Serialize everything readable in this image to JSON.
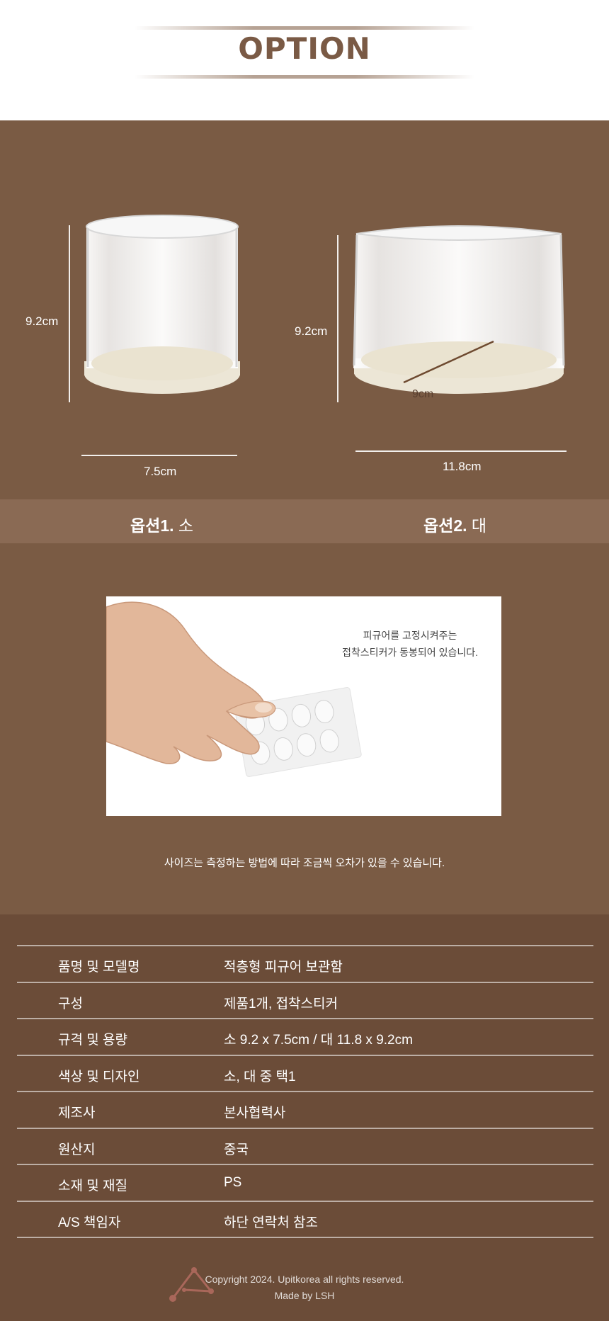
{
  "header": {
    "title": "OPTION"
  },
  "options": {
    "small": {
      "height_label": "9.2cm",
      "width_label": "7.5cm",
      "name_bold": "옵션1.",
      "name_size": "소"
    },
    "large": {
      "height_label": "9.2cm",
      "diameter_label": "9cm",
      "width_label": "11.8cm",
      "name_bold": "옵션2.",
      "name_size": "대"
    }
  },
  "sticker_photo": {
    "caption_line1": "피규어를 고정시켜주는",
    "caption_line2": "접착스티커가 동봉되어 있습니다."
  },
  "size_note": "사이즈는 측정하는 방법에 따라 조금씩 오차가 있을 수 있습니다.",
  "spec_table": {
    "rows": [
      {
        "key": "품명 및 모델명",
        "value": "적층형 피규어 보관함"
      },
      {
        "key": "구성",
        "value": "제품1개, 접착스티커"
      },
      {
        "key": "규격 및 용량",
        "value": "소 9.2 x 7.5cm / 대 11.8 x 9.2cm"
      },
      {
        "key": "색상 및 디자인",
        "value": "소, 대 중 택1"
      },
      {
        "key": "제조사",
        "value": "본사협력사"
      },
      {
        "key": "원산지",
        "value": "중국"
      },
      {
        "key": "소재 및 재질",
        "value": "PS"
      },
      {
        "key": "A/S 책임자",
        "value": "하단 연락처 참조"
      }
    ]
  },
  "footer": {
    "copyright": "Copyright 2024. Upitkorea all rights reserved.",
    "made_by": "Made by LSH"
  }
}
